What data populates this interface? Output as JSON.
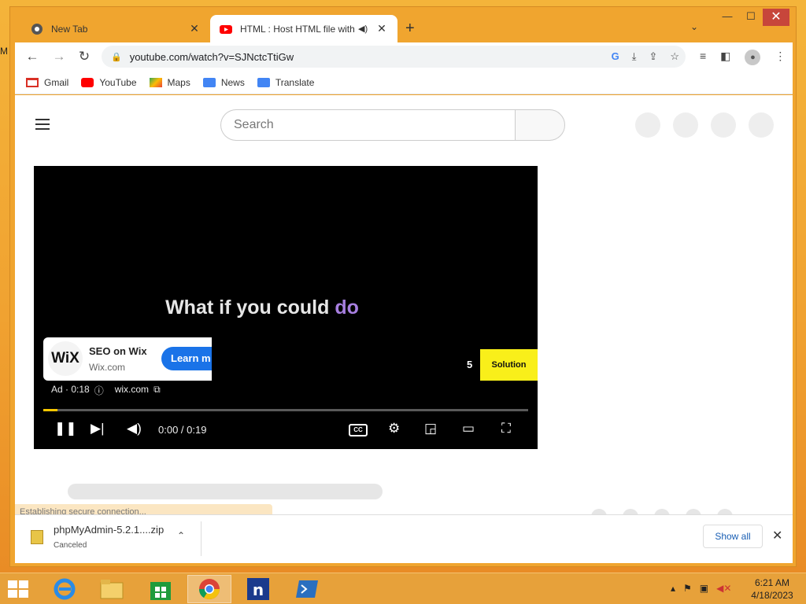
{
  "browser": {
    "tabs": [
      {
        "title": "New Tab"
      },
      {
        "title": "HTML : Host HTML file with"
      }
    ],
    "address": "youtube.com/watch?v=SJNctcTtiGw",
    "bookmarks": [
      {
        "label": "Gmail",
        "color": "#d93025"
      },
      {
        "label": "YouTube",
        "color": "#ff0000"
      },
      {
        "label": "Maps",
        "color": "#34a853"
      },
      {
        "label": "News",
        "color": "#4285f4"
      },
      {
        "label": "Translate",
        "color": "#4285f4"
      }
    ]
  },
  "youtube": {
    "search_placeholder": "Search",
    "video_text_main": "What if you could",
    "video_text_highlight": "do",
    "ad": {
      "title": "SEO on Wix",
      "domain": "Wix.com",
      "cta": "Learn m",
      "logo": "WiX",
      "info_prefix": "Ad · 0:18",
      "info_link": "wix.com"
    },
    "skip_count": "5",
    "skip_label": "Solution",
    "time": "0:00 / 0:19",
    "progress": 0.03,
    "cc": "CC"
  },
  "status": "Establishing secure connection...",
  "download": {
    "filename": "phpMyAdmin-5.2.1....zip",
    "status": "Canceled",
    "show_all": "Show all"
  },
  "taskbar": {
    "clock_time": "6:21 AM",
    "clock_date": "4/18/2023"
  },
  "desktop_letter": "M",
  "colors": {
    "accent_yt": "#ff0000",
    "progress": "#f7c700",
    "skip": "#f9ef1a",
    "cta": "#1a73e8"
  }
}
